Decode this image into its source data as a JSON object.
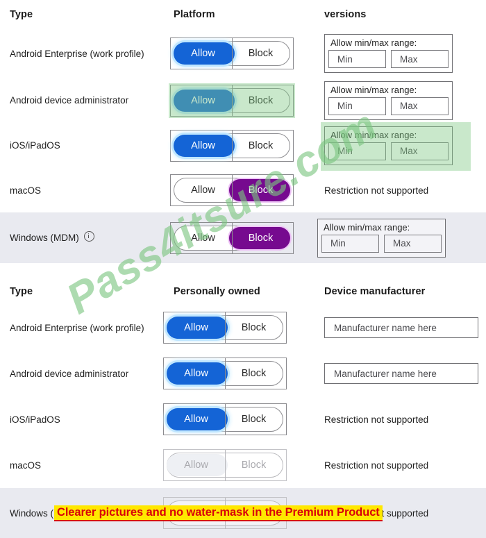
{
  "tables": [
    {
      "id": "platform-versions-table",
      "headers": {
        "type": "Type",
        "middle": "Platform",
        "right": "versions"
      },
      "rows": [
        {
          "type": "Android Enterprise (work profile)",
          "toggle": {
            "left": "Allow",
            "right": "Block",
            "selected": "Allow",
            "color": "#1464d6",
            "state": "enabled"
          },
          "right_kind": "range",
          "range": {
            "label": "Allow min/max range:",
            "min": "Min",
            "max": "Max"
          },
          "shaded": false,
          "highlight": "none"
        },
        {
          "type": "Android device administrator",
          "toggle": {
            "left": "Allow",
            "right": "Block",
            "selected": "Allow",
            "color": "#1464d6",
            "state": "enabled"
          },
          "right_kind": "range",
          "range": {
            "label": "Allow min/max range:",
            "min": "Min",
            "max": "Max"
          },
          "shaded": false,
          "highlight": "toggle"
        },
        {
          "type": "iOS/iPadOS",
          "toggle": {
            "left": "Allow",
            "right": "Block",
            "selected": "Allow",
            "color": "#1464d6",
            "state": "enabled"
          },
          "right_kind": "range",
          "range": {
            "label": "Allow min/max range:",
            "min": "Min",
            "max": "Max"
          },
          "shaded": false,
          "highlight": "range"
        },
        {
          "type": "macOS",
          "toggle": {
            "left": "Allow",
            "right": "Block",
            "selected": "Block",
            "color": "#760a8f",
            "state": "enabled"
          },
          "right_kind": "text",
          "right_text": "Restriction not supported",
          "shaded": false,
          "highlight": "none"
        },
        {
          "type": "Windows (MDM)",
          "has_info_icon": true,
          "toggle": {
            "left": "Allow",
            "right": "Block",
            "selected": "Block",
            "color": "#760a8f",
            "state": "enabled"
          },
          "right_kind": "range",
          "range": {
            "label": "Allow min/max range:",
            "min": "Min",
            "max": "Max"
          },
          "shaded": true,
          "highlight": "none"
        }
      ]
    },
    {
      "id": "personally-owned-manufacturer-table",
      "headers": {
        "type": "Type",
        "middle": "Personally owned",
        "right": "Device manufacturer"
      },
      "rows": [
        {
          "type": "Android Enterprise (work profile)",
          "toggle": {
            "left": "Allow",
            "right": "Block",
            "selected": "Allow",
            "color": "#1464d6",
            "state": "enabled"
          },
          "right_kind": "input",
          "input_placeholder": "Manufacturer name here",
          "shaded": false,
          "highlight": "none"
        },
        {
          "type": "Android device administrator",
          "toggle": {
            "left": "Allow",
            "right": "Block",
            "selected": "Allow",
            "color": "#1464d6",
            "state": "enabled"
          },
          "right_kind": "input",
          "input_placeholder": "Manufacturer name here",
          "shaded": false,
          "highlight": "none"
        },
        {
          "type": "iOS/iPadOS",
          "toggle": {
            "left": "Allow",
            "right": "Block",
            "selected": "Allow",
            "color": "#1464d6",
            "state": "enabled"
          },
          "right_kind": "text",
          "right_text": "Restriction not supported",
          "shaded": false,
          "highlight": "none"
        },
        {
          "type": "macOS",
          "toggle": {
            "left": "Allow",
            "right": "Block",
            "selected": "none",
            "color": "#a9a9ae",
            "state": "disabled"
          },
          "right_kind": "text",
          "right_text": "Restriction not supported",
          "shaded": false,
          "highlight": "none"
        },
        {
          "type": "Windows (MDM)",
          "has_info_icon": true,
          "toggle": {
            "left": "Allow",
            "right": "Block",
            "selected": "none",
            "color": "#a9a9ae",
            "state": "disabled"
          },
          "right_kind": "text",
          "right_text": "Restriction not supported",
          "shaded": true,
          "highlight": "none"
        }
      ]
    }
  ],
  "watermark": {
    "text": "Pass4itsure.com",
    "color": "#7ac580"
  },
  "banner": {
    "text": "Clearer pictures and no water-mask in the Premium Product",
    "text_color": "#d8000a",
    "background_color": "#ffe800"
  }
}
